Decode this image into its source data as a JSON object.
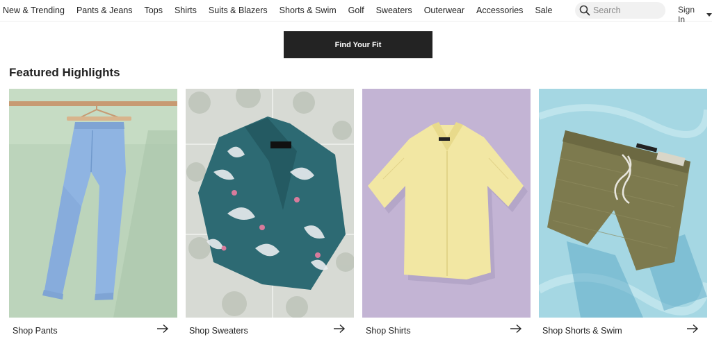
{
  "nav": {
    "items": [
      "New & Trending",
      "Pants & Jeans",
      "Tops",
      "Shirts",
      "Suits & Blazers",
      "Shorts & Swim",
      "Golf",
      "Sweaters",
      "Outerwear",
      "Accessories",
      "Sale"
    ],
    "search_placeholder": "Search",
    "search_value": "",
    "sign_in": "Sign In"
  },
  "hero": {
    "button": "Find Your Fit"
  },
  "featured": {
    "heading": "Featured Highlights",
    "cards": [
      {
        "label": "Shop Pants",
        "image": "light blue chinos on hanger",
        "bg": "#bcd4bb"
      },
      {
        "label": "Shop Sweaters",
        "image": "teal floral knit shirt on tiles",
        "bg": "#cdd1cb"
      },
      {
        "label": "Shop Shirts",
        "image": "yellow camp collar shirt",
        "bg": "#c3b4d4"
      },
      {
        "label": "Shop Shorts & Swim",
        "image": "olive swim shorts on water",
        "bg": "#a5d7e3"
      }
    ]
  },
  "icons": {
    "search": "search-icon",
    "caret": "caret-down-icon",
    "arrow": "arrow-right-icon"
  },
  "colors": {
    "button_bg": "#232323",
    "text": "#222222"
  }
}
